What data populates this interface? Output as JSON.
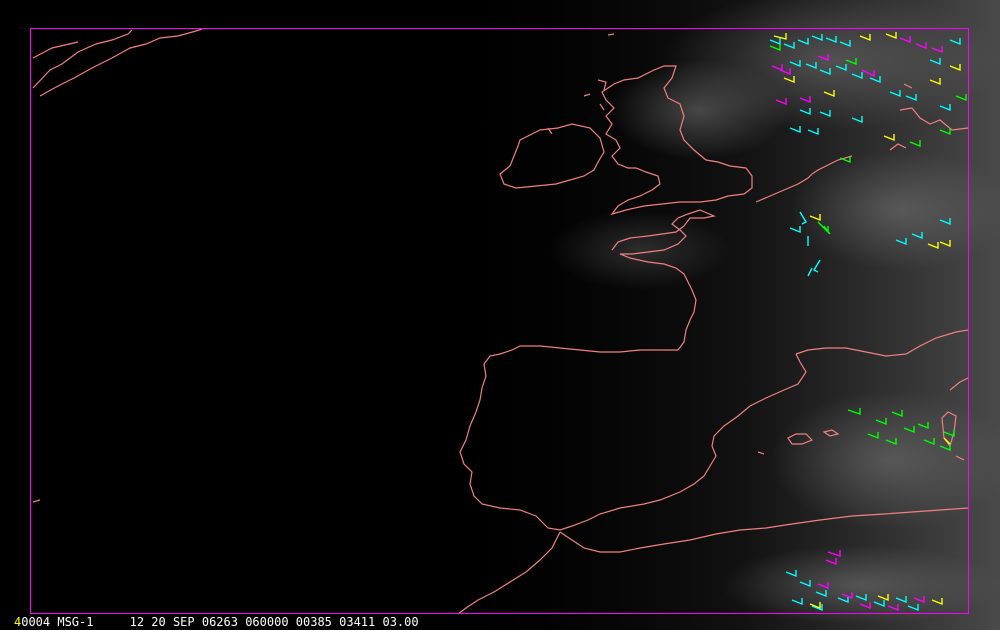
{
  "status_bar": {
    "frame_number": "4",
    "text": "0004 MSG-1     12 20 SEP 06263 060000 00385 03411 03.00"
  },
  "colors": {
    "background": "#000000",
    "coastline": "#f08080",
    "frame_border": "#ff00ff",
    "status_text": "#ffffff",
    "frame_number": "#ffff00",
    "wind_barbs": [
      "#00ffff",
      "#ffff00",
      "#ff00ff",
      "#00ff00"
    ]
  },
  "map": {
    "type": "satellite-image",
    "overlays": [
      "coastlines",
      "wind-barbs"
    ]
  }
}
